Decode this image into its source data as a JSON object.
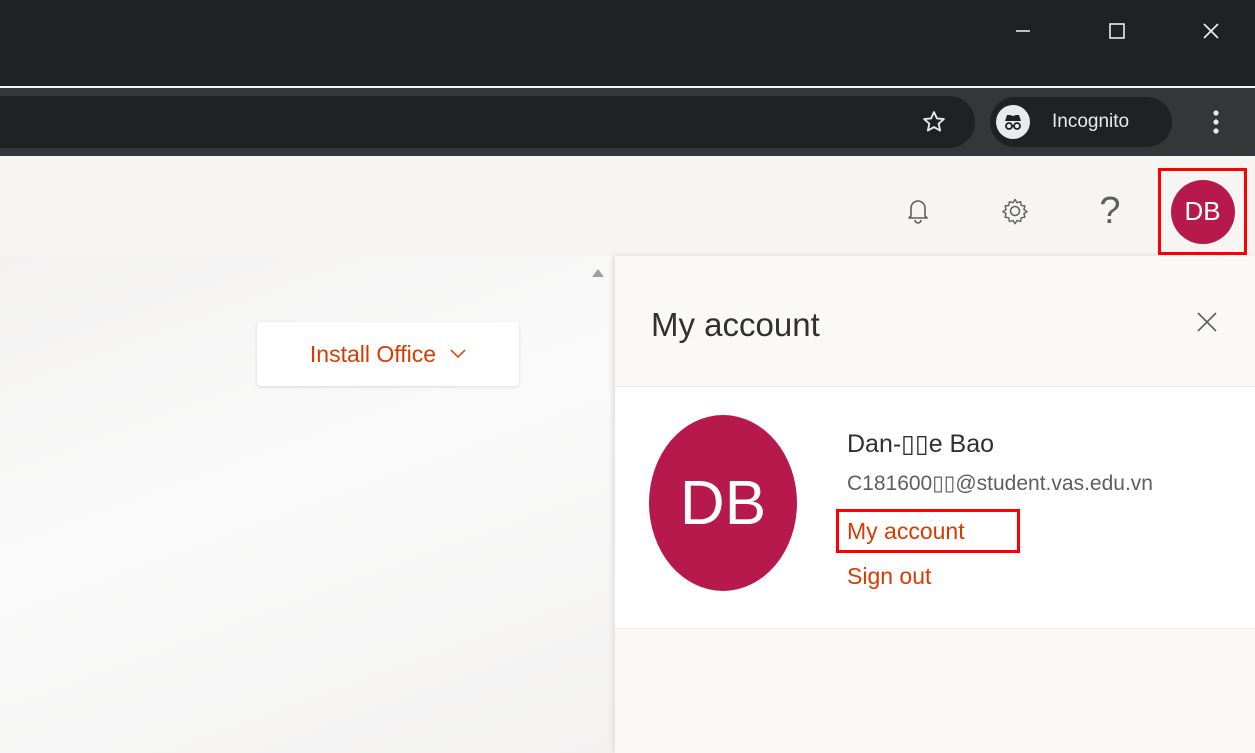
{
  "browser": {
    "profile_label": "Incognito"
  },
  "office": {
    "install_label": "Install Office",
    "avatar_initials": "DB"
  },
  "account_panel": {
    "title": "My account",
    "avatar_initials": "DB",
    "user_name": "Dan-▯▯e Bao",
    "user_email": "C181600▯▯@student.vas.edu.vn",
    "my_account_link": "My account",
    "sign_out_link": "Sign out"
  },
  "colors": {
    "accent": "#d83b01",
    "avatar_bg": "#b8194d",
    "highlight": "#ff0000"
  }
}
